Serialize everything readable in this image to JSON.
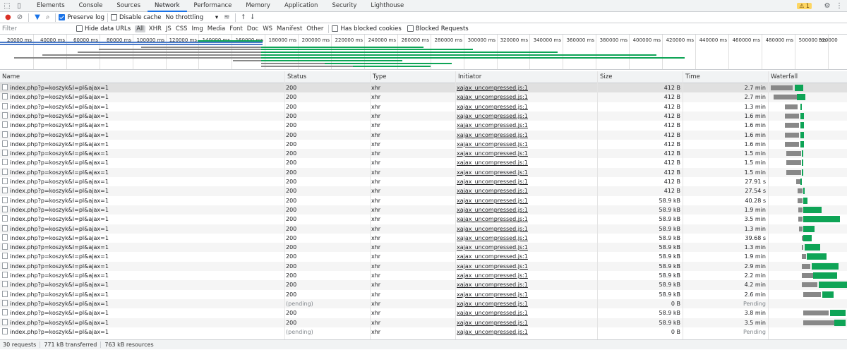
{
  "tabs": {
    "items": [
      "Elements",
      "Console",
      "Sources",
      "Network",
      "Performance",
      "Memory",
      "Application",
      "Security",
      "Lighthouse"
    ],
    "active": "Network",
    "warnings": "1"
  },
  "toolbar": {
    "preserve_log": "Preserve log",
    "disable_cache": "Disable cache",
    "throttling": "No throttling"
  },
  "filterbar": {
    "placeholder": "Filter",
    "hide_data_urls": "Hide data URLs",
    "types": [
      "All",
      "XHR",
      "JS",
      "CSS",
      "Img",
      "Media",
      "Font",
      "Doc",
      "WS",
      "Manifest",
      "Other"
    ],
    "selected_type": "All",
    "blocked_cookies": "Has blocked cookies",
    "blocked_requests": "Blocked Requests"
  },
  "overview": {
    "ticks": [
      "20000 ms",
      "40000 ms",
      "60000 ms",
      "80000 ms",
      "100000 ms",
      "120000 ms",
      "140000 ms",
      "160000 ms",
      "180000 ms",
      "200000 ms",
      "220000 ms",
      "240000 ms",
      "260000 ms",
      "280000 ms",
      "300000 ms",
      "320000 ms",
      "340000 ms",
      "360000 ms",
      "380000 ms",
      "400000 ms",
      "420000 ms",
      "440000 ms",
      "460000 ms",
      "480000 ms",
      "500000 ms",
      "520000"
    ]
  },
  "columns": {
    "name": "Name",
    "status": "Status",
    "type": "Type",
    "initiator": "Initiator",
    "size": "Size",
    "time": "Time",
    "waterfall": "Waterfall"
  },
  "rows": [
    {
      "name": "index.php?p=koszyk&l=pl&ajax=1",
      "status": "200",
      "type": "xhr",
      "initiator": "xajax_uncompressed.js:1",
      "size": "412 B",
      "time": "2.7 min",
      "wf": [
        2,
        31,
        36,
        12
      ]
    },
    {
      "name": "index.php?p=koszyk&l=pl&ajax=1",
      "status": "200",
      "type": "xhr",
      "initiator": "xajax_uncompressed.js:1",
      "size": "412 B",
      "time": "2.7 min",
      "wf": [
        6,
        33,
        39,
        12
      ]
    },
    {
      "name": "index.php?p=koszyk&l=pl&ajax=1",
      "status": "200",
      "type": "xhr",
      "initiator": "xajax_uncompressed.js:1",
      "size": "412 B",
      "time": "1.3 min",
      "wf": [
        22,
        18,
        44,
        2
      ]
    },
    {
      "name": "index.php?p=koszyk&l=pl&ajax=1",
      "status": "200",
      "type": "xhr",
      "initiator": "xajax_uncompressed.js:1",
      "size": "412 B",
      "time": "1.6 min",
      "wf": [
        22,
        20,
        44,
        5
      ]
    },
    {
      "name": "index.php?p=koszyk&l=pl&ajax=1",
      "status": "200",
      "type": "xhr",
      "initiator": "xajax_uncompressed.js:1",
      "size": "412 B",
      "time": "1.6 min",
      "wf": [
        22,
        20,
        44,
        5
      ]
    },
    {
      "name": "index.php?p=koszyk&l=pl&ajax=1",
      "status": "200",
      "type": "xhr",
      "initiator": "xajax_uncompressed.js:1",
      "size": "412 B",
      "time": "1.6 min",
      "wf": [
        22,
        20,
        44,
        5
      ]
    },
    {
      "name": "index.php?p=koszyk&l=pl&ajax=1",
      "status": "200",
      "type": "xhr",
      "initiator": "xajax_uncompressed.js:1",
      "size": "412 B",
      "time": "1.6 min",
      "wf": [
        22,
        20,
        44,
        5
      ]
    },
    {
      "name": "index.php?p=koszyk&l=pl&ajax=1",
      "status": "200",
      "type": "xhr",
      "initiator": "xajax_uncompressed.js:1",
      "size": "412 B",
      "time": "1.5 min",
      "wf": [
        24,
        21,
        46,
        2
      ]
    },
    {
      "name": "index.php?p=koszyk&l=pl&ajax=1",
      "status": "200",
      "type": "xhr",
      "initiator": "xajax_uncompressed.js:1",
      "size": "412 B",
      "time": "1.5 min",
      "wf": [
        24,
        21,
        46,
        2
      ]
    },
    {
      "name": "index.php?p=koszyk&l=pl&ajax=1",
      "status": "200",
      "type": "xhr",
      "initiator": "xajax_uncompressed.js:1",
      "size": "412 B",
      "time": "1.5 min",
      "wf": [
        24,
        21,
        46,
        2
      ]
    },
    {
      "name": "index.php?p=koszyk&l=pl&ajax=1",
      "status": "200",
      "type": "xhr",
      "initiator": "xajax_uncompressed.js:1",
      "size": "412 B",
      "time": "27.91 s",
      "wf": [
        38,
        6,
        44,
        2
      ]
    },
    {
      "name": "index.php?p=koszyk&l=pl&ajax=1",
      "status": "200",
      "type": "xhr",
      "initiator": "xajax_uncompressed.js:1",
      "size": "412 B",
      "time": "27.54 s",
      "wf": [
        40,
        7,
        48,
        2
      ]
    },
    {
      "name": "index.php?p=koszyk&l=pl&ajax=1",
      "status": "200",
      "type": "xhr",
      "initiator": "xajax_uncompressed.js:1",
      "size": "58.9 kB",
      "time": "40.28 s",
      "wf": [
        40,
        7,
        48,
        6
      ]
    },
    {
      "name": "index.php?p=koszyk&l=pl&ajax=1",
      "status": "200",
      "type": "xhr",
      "initiator": "xajax_uncompressed.js:1",
      "size": "58.9 kB",
      "time": "1.9 min",
      "wf": [
        41,
        6,
        48,
        26
      ]
    },
    {
      "name": "index.php?p=koszyk&l=pl&ajax=1",
      "status": "200",
      "type": "xhr",
      "initiator": "xajax_uncompressed.js:1",
      "size": "58.9 kB",
      "time": "3.5 min",
      "wf": [
        41,
        6,
        48,
        52
      ]
    },
    {
      "name": "index.php?p=koszyk&l=pl&ajax=1",
      "status": "200",
      "type": "xhr",
      "initiator": "xajax_uncompressed.js:1",
      "size": "58.9 kB",
      "time": "1.3 min",
      "wf": [
        42,
        5,
        48,
        16
      ]
    },
    {
      "name": "index.php?p=koszyk&l=pl&ajax=1",
      "status": "200",
      "type": "xhr",
      "initiator": "xajax_uncompressed.js:1",
      "size": "58.9 kB",
      "time": "39.68 s",
      "wf": [
        46,
        2,
        48,
        12
      ]
    },
    {
      "name": "index.php?p=koszyk&l=pl&ajax=1",
      "status": "200",
      "type": "xhr",
      "initiator": "xajax_uncompressed.js:1",
      "size": "58.9 kB",
      "time": "1.3 min",
      "wf": [
        46,
        2,
        50,
        22
      ]
    },
    {
      "name": "index.php?p=koszyk&l=pl&ajax=1",
      "status": "200",
      "type": "xhr",
      "initiator": "xajax_uncompressed.js:1",
      "size": "58.9 kB",
      "time": "1.9 min",
      "wf": [
        46,
        6,
        53,
        28
      ]
    },
    {
      "name": "index.php?p=koszyk&l=pl&ajax=1",
      "status": "200",
      "type": "xhr",
      "initiator": "xajax_uncompressed.js:1",
      "size": "58.9 kB",
      "time": "2.9 min",
      "wf": [
        46,
        12,
        60,
        38
      ]
    },
    {
      "name": "index.php?p=koszyk&l=pl&ajax=1",
      "status": "200",
      "type": "xhr",
      "initiator": "xajax_uncompressed.js:1",
      "size": "58.9 kB",
      "time": "2.2 min",
      "wf": [
        46,
        16,
        62,
        34
      ]
    },
    {
      "name": "index.php?p=koszyk&l=pl&ajax=1",
      "status": "200",
      "type": "xhr",
      "initiator": "xajax_uncompressed.js:1",
      "size": "58.9 kB",
      "time": "4.2 min",
      "wf": [
        46,
        22,
        70,
        40
      ]
    },
    {
      "name": "index.php?p=koszyk&l=pl&ajax=1",
      "status": "200",
      "type": "xhr",
      "initiator": "xajax_uncompressed.js:1",
      "size": "58.9 kB",
      "time": "2.6 min",
      "wf": [
        48,
        25,
        75,
        16
      ]
    },
    {
      "name": "index.php?p=koszyk&l=pl&ajax=1",
      "status": "(pending)",
      "type": "xhr",
      "initiator": "xajax_uncompressed.js:1",
      "size": "0 B",
      "time": "Pending",
      "wf": []
    },
    {
      "name": "index.php?p=koszyk&l=pl&ajax=1",
      "status": "200",
      "type": "xhr",
      "initiator": "xajax_uncompressed.js:1",
      "size": "58.9 kB",
      "time": "3.8 min",
      "wf": [
        48,
        36,
        86,
        22
      ]
    },
    {
      "name": "index.php?p=koszyk&l=pl&ajax=1",
      "status": "200",
      "type": "xhr",
      "initiator": "xajax_uncompressed.js:1",
      "size": "58.9 kB",
      "time": "3.5 min",
      "wf": [
        48,
        44,
        92,
        16
      ]
    },
    {
      "name": "index.php?p=koszyk&l=pl&ajax=1",
      "status": "(pending)",
      "type": "xhr",
      "initiator": "xajax_uncompressed.js:1",
      "size": "0 B",
      "time": "Pending",
      "wf": []
    }
  ],
  "statusbar": {
    "requests": "30 requests",
    "transferred": "771 kB transferred",
    "resources": "763 kB resources"
  }
}
